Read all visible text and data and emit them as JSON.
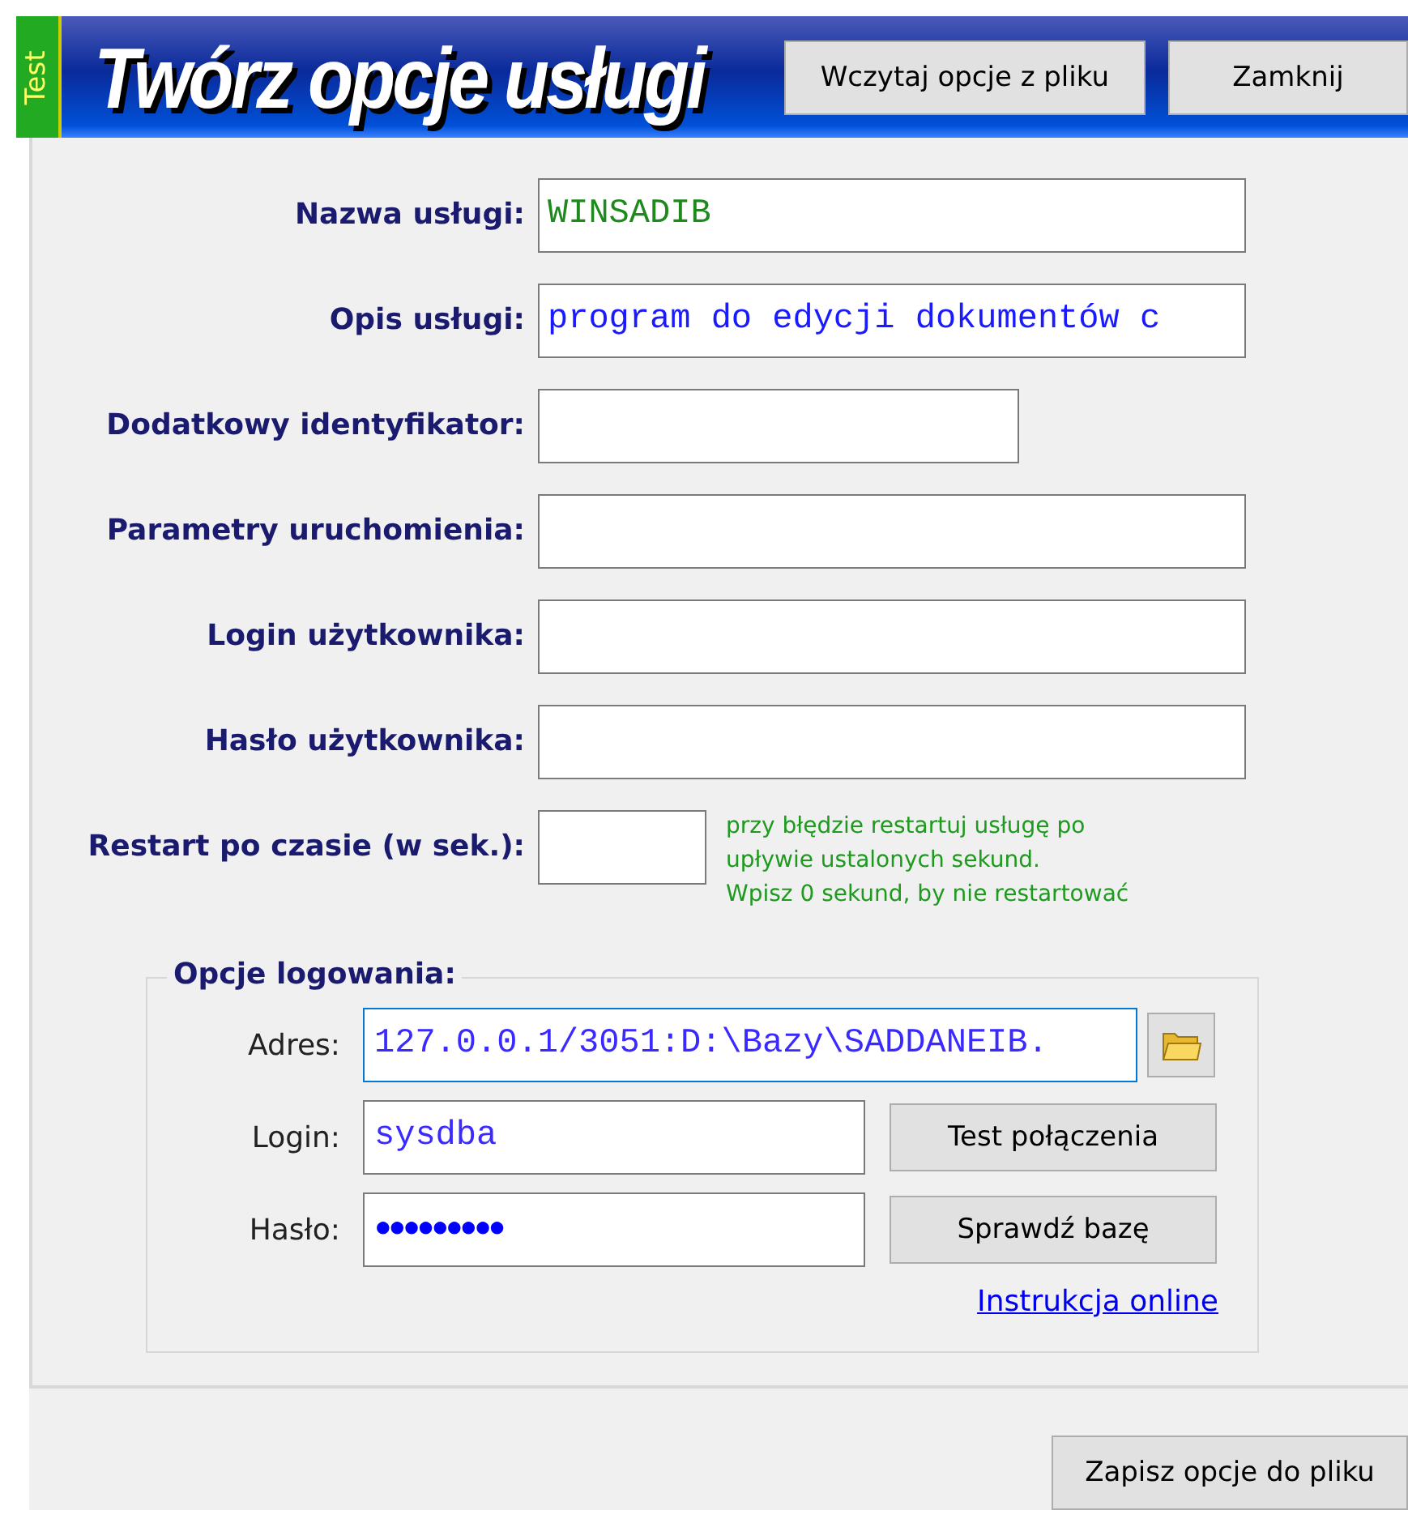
{
  "header": {
    "badge": "Test",
    "title": "Twórz opcje usługi",
    "buttons": [
      "Wczytaj opcje z pliku",
      "Zamknij"
    ]
  },
  "fields": [
    {
      "label": "Nazwa usługi:",
      "value": "WINSADIB",
      "kind": "wide",
      "color": "#1e8a1e"
    },
    {
      "label": "Opis usługi:",
      "value": "program do edycji dokumentów c",
      "kind": "wide",
      "color": "#1a1aff"
    },
    {
      "label": "Dodatkowy identyfikator:",
      "kind": "medium"
    },
    {
      "label": "Parametry uruchomienia:",
      "kind": "wide"
    },
    {
      "label": "Login użytkownika:",
      "kind": "wide"
    },
    {
      "label": "Hasło użytkownika:",
      "kind": "wide"
    },
    {
      "label": "Restart po czasie (w sek.):",
      "kind": "short",
      "hint": [
        "przy błędzie restartuj usługę po",
        "upływie ustalonych sekund.",
        "Wpisz 0 sekund, by nie restartować"
      ]
    }
  ],
  "login_options": {
    "title": "Opcje logowania:",
    "address": {
      "label": "Adres:",
      "value": "127.0.0.1/3051:D:\\Bazy\\SADDANEIB.",
      "focused": true
    },
    "login": {
      "label": "Login:",
      "value": "sysdba"
    },
    "password": {
      "label": "Hasło:",
      "value": "●●●●●●●●●"
    },
    "buttons": [
      "Test połączenia",
      "Sprawdź bazę"
    ],
    "link": "Instrukcja online"
  },
  "save_button": "Zapisz opcje do pliku"
}
